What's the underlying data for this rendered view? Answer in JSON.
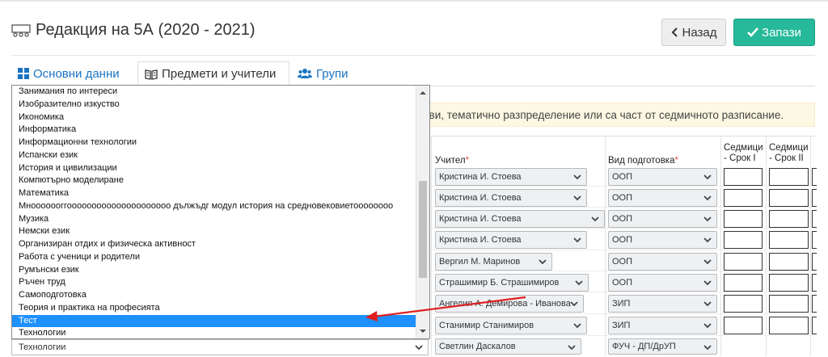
{
  "page": {
    "title": "Редакция на 5А (2020 - 2021)",
    "back_label": "Назад",
    "save_label": "Запази"
  },
  "tabs": [
    {
      "label": "Основни данни"
    },
    {
      "label": "Предмети и учители"
    },
    {
      "label": "Групи"
    }
  ],
  "alert": {
    "text": "иви, тематично разпределение или са част от седмичното разписание."
  },
  "table": {
    "col_teacher": "Учител",
    "col_training": "Вид подготовка",
    "col_weekly1_line1": "Седмици",
    "col_weekly1_line2": "- Срок I",
    "col_weekly2_line1": "Седмици",
    "col_weekly2_line2": "- Срок II",
    "rows": [
      {
        "teacher": "Кристина И. Стоева",
        "training": "ООП"
      },
      {
        "teacher": "Кристина И. Стоева",
        "training": "ООП"
      },
      {
        "teacher": "Кристина И. Стоева",
        "training": "ООП"
      },
      {
        "teacher": "Кристина И. Стоева",
        "training": "ООП"
      },
      {
        "teacher": "Вергил М. Маринов",
        "training": "ООП"
      },
      {
        "teacher": "Страшимир Б. Страшимиров",
        "training": "ООП"
      },
      {
        "teacher": "Ангелия А. Демирова - Иванова",
        "training": "ЗИП"
      },
      {
        "teacher": "Станимир Станимиров",
        "training": "ЗИП"
      },
      {
        "teacher": "Светлин Даскалов",
        "training": "ФУЧ - ДП/ДрУП"
      }
    ],
    "last_row_subject": "Технологии"
  },
  "dropdown": {
    "items": [
      "Занимания по интереси",
      "Изобразително изкуство",
      "Икономика",
      "Информатика",
      "Информационни технологии",
      "Испански език",
      "История и цивилизации",
      "Компютърно моделиране",
      "Математика",
      "Мнооооооггооооооооооооооооооооо дължъдг модул история на средновековиетоооооооо",
      "Музика",
      "Немски език",
      "Организиран отдих и физическа активност",
      "Работа с ученици и родители",
      "Румънски език",
      "Ръчен труд",
      "Самоподготовка",
      "Теория и практика на професията",
      "Тест",
      "Технологии"
    ],
    "selected_index": 18
  },
  "colors": {
    "accent": "#26b99a",
    "link": "#1a73c2",
    "highlight": "#1e90ff",
    "arrow": "#e02020"
  }
}
